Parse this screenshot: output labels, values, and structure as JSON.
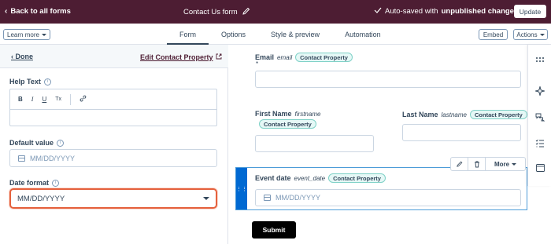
{
  "topbar": {
    "back_label": "Back to all forms",
    "form_title": "Contact Us form",
    "autosave_prefix": "Auto-saved with",
    "autosave_status": "unpublished changes",
    "update_label": "Update"
  },
  "subbar": {
    "learn_more_label": "Learn more",
    "tabs": [
      "Form",
      "Options",
      "Style & preview",
      "Automation"
    ],
    "active_tab": "Form",
    "embed_label": "Embed",
    "actions_label": "Actions"
  },
  "left_panel": {
    "done_label": "Done",
    "edit_property_label": "Edit Contact Property",
    "help_text_label": "Help Text",
    "rte_buttons": [
      "B",
      "I",
      "U",
      "Tx"
    ],
    "default_value_label": "Default value",
    "default_value_placeholder": "MM/DD/YYYY",
    "date_format_label": "Date format",
    "date_format_value": "MM/DD/YYYY"
  },
  "form": {
    "email": {
      "label": "Email",
      "internal": "email",
      "required_marker": "*",
      "pill": "Contact Property"
    },
    "first_name": {
      "label": "First Name",
      "internal": "firstname",
      "pill": "Contact Property"
    },
    "last_name": {
      "label": "Last Name",
      "internal": "lastname",
      "pill": "Contact Property"
    },
    "event_date": {
      "label": "Event date",
      "internal": "event_date",
      "pill": "Contact Property",
      "placeholder": "MM/DD/YYYY"
    },
    "field_toolbar_more": "More",
    "submit_label": "Submit"
  },
  "colors": {
    "topbar_bg": "#4d1d33",
    "selected_accent": "#0069d2",
    "highlight_border": "#e5613d",
    "pill_bg": "#e5f8f6"
  }
}
